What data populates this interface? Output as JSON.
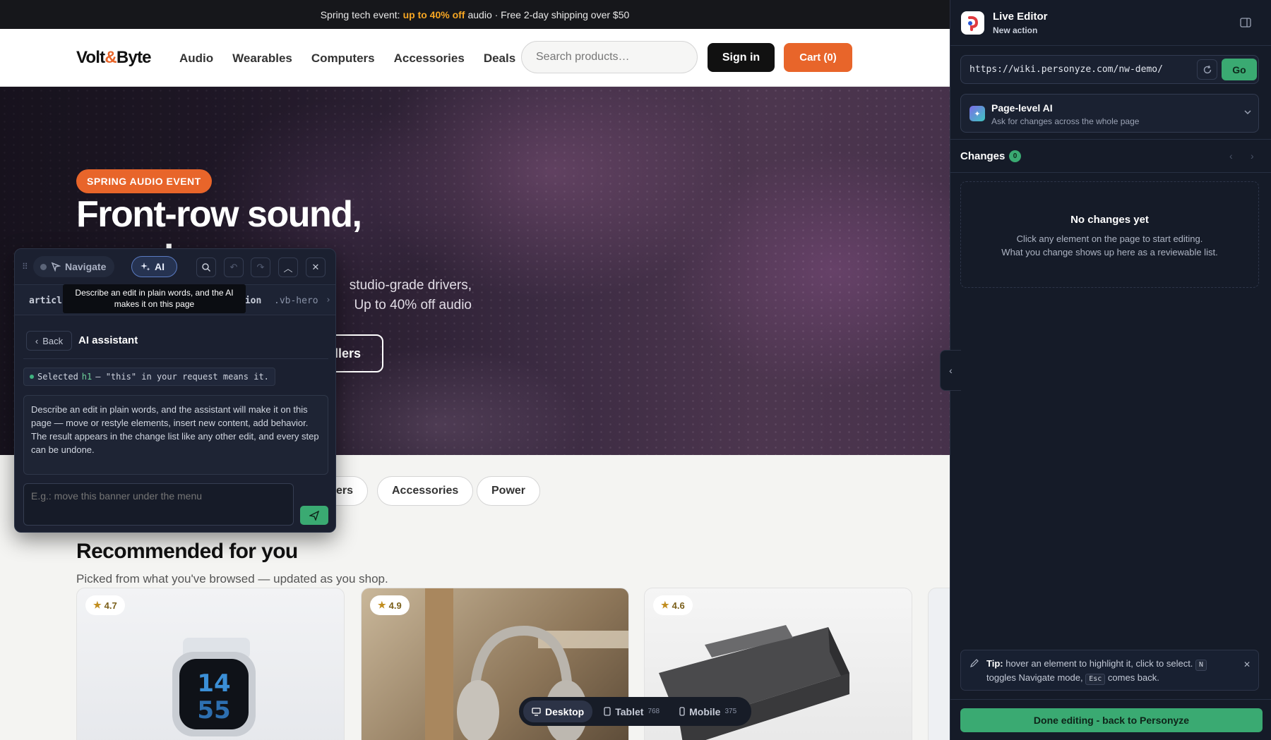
{
  "announcement": {
    "prefix": "Spring tech event:",
    "highlight": "up to 40% off",
    "suffix": "audio · Free 2-day shipping over $50"
  },
  "header": {
    "logo_left": "Volt",
    "logo_amp": "&",
    "logo_right": "Byte",
    "nav": [
      "Audio",
      "Wearables",
      "Computers",
      "Accessories",
      "Deals"
    ],
    "search_placeholder": "Search products…",
    "sign_in": "Sign in",
    "cart": "Cart (0)"
  },
  "hero": {
    "badge": "SPRING AUDIO EVENT",
    "title_line1": "Front-row sound,",
    "title_line2": "anywhere",
    "subtitle_line1": "studio-grade drivers,",
    "subtitle_line2": "Up to 40% off audio",
    "cta": "llers"
  },
  "categories": {
    "visible_chips": [
      "ters",
      "Accessories",
      "Power"
    ]
  },
  "recommended": {
    "title": "Recommended for you",
    "subtitle": "Picked from what you've browsed — updated as you shop.",
    "cards": [
      {
        "rating": "4.7",
        "image": "smartwatch"
      },
      {
        "rating": "4.9",
        "image": "headphones"
      },
      {
        "rating": "4.6",
        "image": "speaker"
      }
    ]
  },
  "floating_panel": {
    "navigate": "Navigate",
    "ai": "AI",
    "tooltip": "Describe an edit in plain words, and the AI makes it on this page",
    "breadcrumb_start": "articl",
    "breadcrumb_tag": "tion",
    "breadcrumb_class": ".vb-hero",
    "back": "Back",
    "title": "AI assistant",
    "selected_prefix": "Selected",
    "selected_tag": "h1",
    "selected_suffix": "— \"this\" in your request means it.",
    "description": "Describe an edit in plain words, and the assistant will make it on this page — move or restyle elements, insert new content, add behavior. The result appears in the change list like any other edit, and every step can be undone.",
    "prompt_placeholder": "E.g.: move this banner under the menu"
  },
  "device_bar": {
    "desktop": "Desktop",
    "tablet": "Tablet",
    "tablet_px": "768",
    "mobile": "Mobile",
    "mobile_px": "375",
    "active": "Desktop"
  },
  "editor": {
    "title": "Live Editor",
    "subtitle": "New action",
    "url": "https://wiki.personyze.com/nw-demo/",
    "go": "Go",
    "page_ai_title": "Page-level AI",
    "page_ai_sub": "Ask for changes across the whole page",
    "changes_title": "Changes",
    "changes_count": "0",
    "empty_title": "No changes yet",
    "empty_line1": "Click any element on the page to start editing.",
    "empty_line2": "What you change shows up here as a reviewable list.",
    "tip_label": "Tip:",
    "tip_part1": "hover an element to highlight it, click to select.",
    "tip_key1": "N",
    "tip_part2": "toggles Navigate mode,",
    "tip_key2": "Esc",
    "tip_part3": "comes back.",
    "done": "Done editing - back to Personyze"
  },
  "colors": {
    "accent_orange": "#e8652a",
    "editor_bg": "#151b28",
    "green": "#3aaa72",
    "announce_highlight": "#f6a623"
  }
}
